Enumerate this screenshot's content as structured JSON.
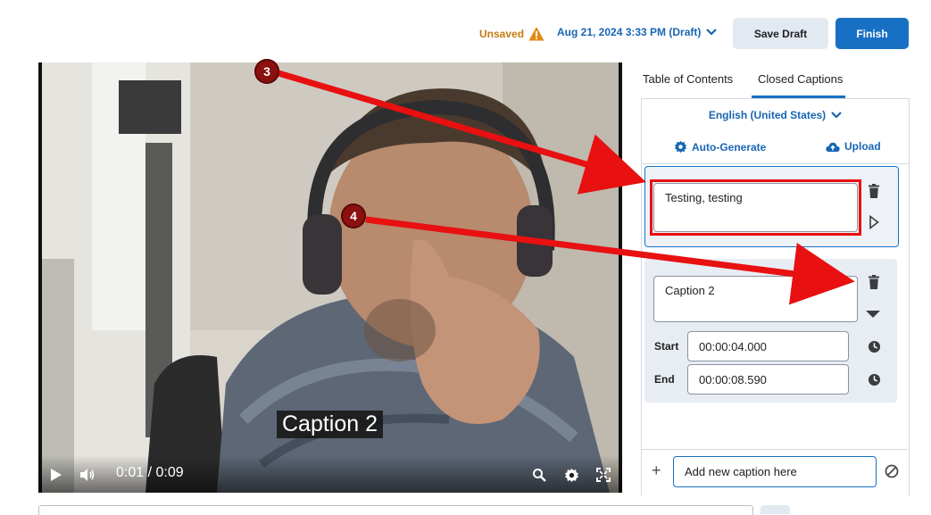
{
  "header": {
    "unsaved_label": "Unsaved",
    "draft_label": "Aug 21, 2024 3:33 PM (Draft)",
    "save_draft": "Save Draft",
    "finish": "Finish"
  },
  "video": {
    "caption_overlay": "Caption 2",
    "time_display": "0:01 / 0:09"
  },
  "tabs": {
    "toc": "Table of Contents",
    "cc": "Closed Captions",
    "active": "Closed Captions"
  },
  "captions_panel": {
    "language": "English (United States)",
    "auto_generate": "Auto-Generate",
    "upload": "Upload",
    "items": [
      {
        "text": "Testing, testing"
      },
      {
        "text": "Caption 2",
        "start_label": "Start",
        "start": "00:00:04.000",
        "end_label": "End",
        "end": "00:00:08.590"
      }
    ],
    "new_caption_value": "Add new caption here"
  },
  "annotations": {
    "badge_3": "3",
    "badge_4": "4"
  },
  "colors": {
    "accent": "#1870c4",
    "warning": "#c47a14",
    "annotation_red": "#e81010",
    "badge": "#8c1010"
  }
}
